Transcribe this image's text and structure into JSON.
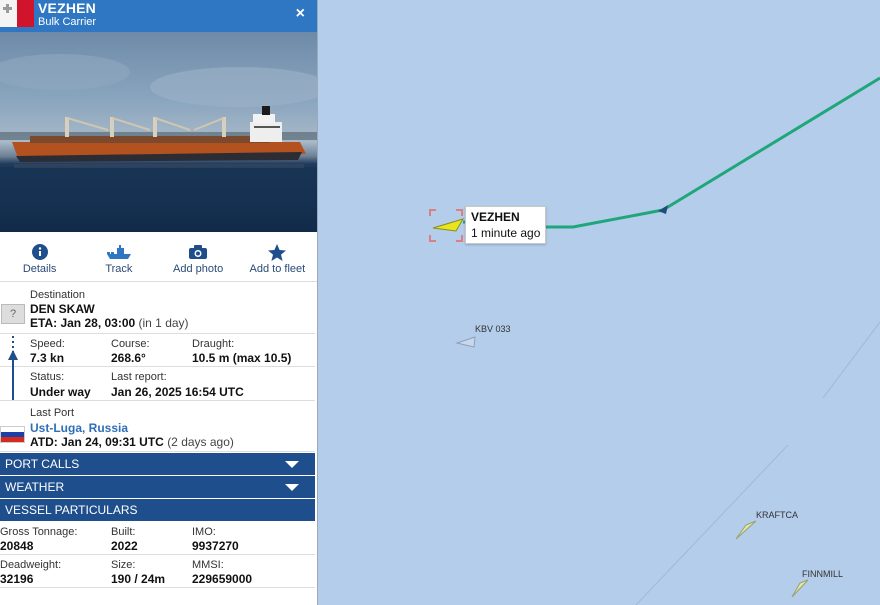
{
  "vessel": {
    "name": "VEZHEN",
    "type": "Bulk Carrier",
    "flag_icon": "malta-flag-icon",
    "close_icon": "×"
  },
  "actions": [
    {
      "label": "Details",
      "icon": "info-icon"
    },
    {
      "label": "Track",
      "icon": "ship-track-icon"
    },
    {
      "label": "Add photo",
      "icon": "camera-icon"
    },
    {
      "label": "Add to fleet",
      "icon": "star-icon"
    }
  ],
  "voyage": {
    "destination_label": "Destination",
    "destination": "DEN SKAW",
    "unknown_flag": "?",
    "eta_label": "ETA:",
    "eta": "Jan 28, 03:00",
    "eta_relative": "(in 1 day)",
    "speed_label": "Speed:",
    "speed": "7.3 kn",
    "course_label": "Course:",
    "course": "268.6°",
    "draught_label": "Draught:",
    "draught": "10.5 m (max 10.5)",
    "status_label": "Status:",
    "status": "Under way",
    "last_report_label": "Last report:",
    "last_report": "Jan 26, 2025 16:54 UTC",
    "last_port_label": "Last Port",
    "last_port": "Ust-Luga, Russia",
    "atd_label": "ATD:",
    "atd": "Jan 24, 09:31 UTC",
    "atd_relative": "(2 days ago)"
  },
  "sections": {
    "port_calls": "PORT CALLS",
    "weather": "WEATHER",
    "particulars": "VESSEL PARTICULARS"
  },
  "particulars": {
    "gross_tonnage_label": "Gross Tonnage:",
    "gross_tonnage": "20848",
    "built_label": "Built:",
    "built": "2022",
    "imo_label": "IMO:",
    "imo": "9937270",
    "deadweight_label": "Deadweight:",
    "deadweight": "32196",
    "size_label": "Size:",
    "size": "190 / 24m",
    "mmsi_label": "MMSI:",
    "mmsi": "229659000"
  },
  "map": {
    "tooltip_name": "VEZHEN",
    "tooltip_time": "1 minute ago",
    "other_vessels": [
      "KBV 033",
      "KRAFTCA",
      "FINNMILL"
    ],
    "sea_color": "#b3cdea",
    "track_color": "#1fa67a"
  }
}
